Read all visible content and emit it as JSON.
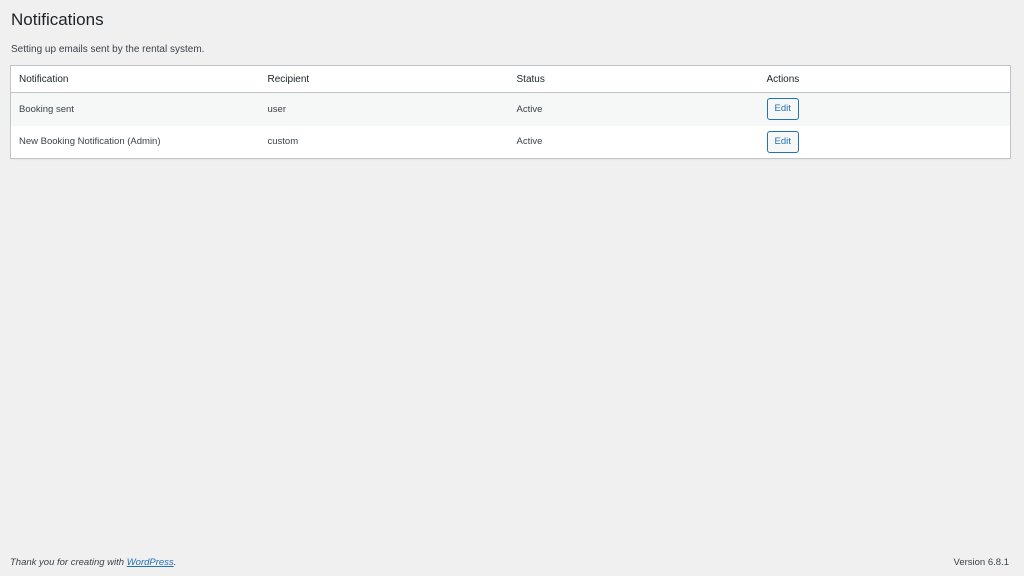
{
  "page": {
    "title": "Notifications",
    "description": "Setting up emails sent by the rental system."
  },
  "table": {
    "headers": [
      "Notification",
      "Recipient",
      "Status",
      "Actions"
    ],
    "rows": [
      {
        "notification": "Booking sent",
        "recipient": "user",
        "status": "Active",
        "action_label": "Edit"
      },
      {
        "notification": "New Booking Notification (Admin)",
        "recipient": "custom",
        "status": "Active",
        "action_label": "Edit"
      }
    ]
  },
  "footer": {
    "thanks_prefix": "Thank you for creating with ",
    "wordpress_link": "WordPress",
    "thanks_suffix": ".",
    "version": "Version 6.8.1"
  },
  "colors": {
    "background": "#f0f0f1",
    "accent": "#2271b1",
    "border": "#c3c4c7"
  }
}
